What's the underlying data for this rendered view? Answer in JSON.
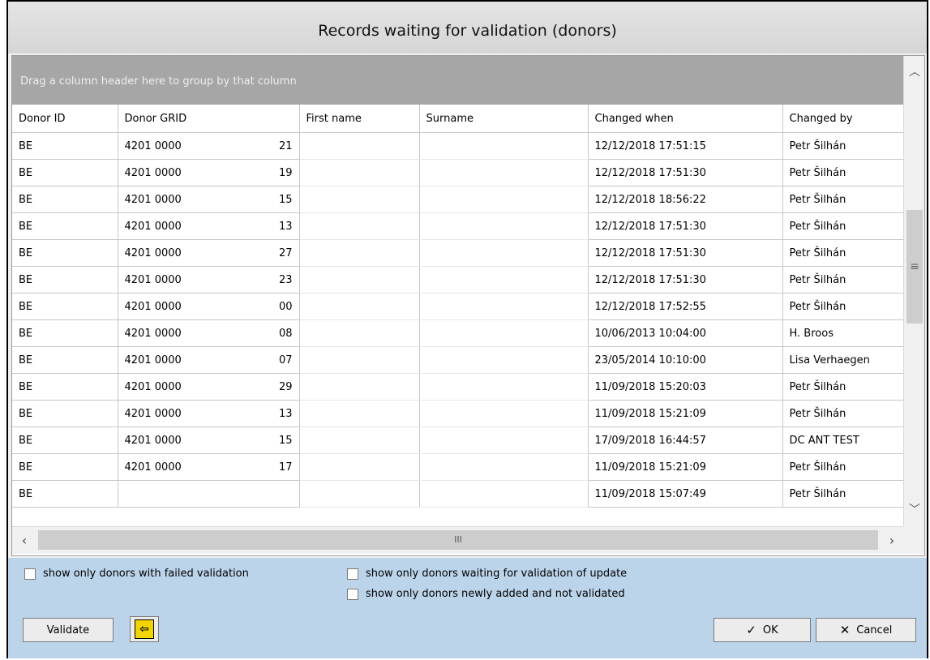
{
  "window": {
    "title": "Records waiting for validation (donors)"
  },
  "grid": {
    "group_hint": "Drag a column header here to group by that column",
    "columns": [
      "Donor ID",
      "Donor GRID",
      "First name",
      "Surname",
      "Changed when",
      "Changed by"
    ],
    "rows": [
      [
        "BE",
        "4201 0000",
        "",
        "",
        "12/12/2018 17:51:15",
        "Petr Šilhán"
      ],
      [
        "BE",
        "4201 0000",
        "",
        "",
        "12/12/2018 17:51:30",
        "Petr Šilhán"
      ],
      [
        "BE",
        "4201 0000",
        "",
        "",
        "12/12/2018 18:56:22",
        "Petr Šilhán"
      ],
      [
        "BE",
        "4201 0000",
        "",
        "",
        "12/12/2018 17:51:30",
        "Petr Šilhán"
      ],
      [
        "BE",
        "4201 0000",
        "",
        "",
        "12/12/2018 17:51:30",
        "Petr Šilhán"
      ],
      [
        "BE",
        "4201 0000",
        "",
        "",
        "12/12/2018 17:51:30",
        "Petr Šilhán"
      ],
      [
        "BE",
        "4201 0000",
        "",
        "",
        "12/12/2018 17:52:55",
        "Petr Šilhán"
      ],
      [
        "BE",
        "4201 0000",
        "",
        "",
        "10/06/2013 10:04:00",
        "H. Broos"
      ],
      [
        "BE",
        "4201 0000",
        "",
        "",
        "23/05/2014 10:10:00",
        "Lisa Verhaegen"
      ],
      [
        "BE",
        "4201 0000",
        "",
        "",
        "11/09/2018 15:20:03",
        "Petr Šilhán"
      ],
      [
        "BE",
        "4201 0000",
        "",
        "",
        "11/09/2018 15:21:09",
        "Petr Šilhán"
      ],
      [
        "BE",
        "4201 0000",
        "",
        "",
        "17/09/2018 16:44:57",
        "DC ANT TEST"
      ],
      [
        "BE",
        "4201 0000",
        "",
        "",
        "11/09/2018 15:21:09",
        "Petr Šilhán"
      ],
      [
        "BE",
        "",
        "",
        "",
        "11/09/2018 15:07:49",
        "Petr Šilhán"
      ]
    ],
    "grid_suffixes": [
      "21",
      "19",
      "15",
      "13",
      "27",
      "23",
      "00",
      "08",
      "07",
      "29",
      "13",
      "15",
      "17",
      ""
    ]
  },
  "filters": {
    "failed": "show only donors with failed validation",
    "update": "show only donors waiting for validation of update",
    "new": "show only donors newly added and not validated"
  },
  "buttons": {
    "validate": "Validate",
    "ok": "OK",
    "cancel": "Cancel"
  },
  "icons": [
    "scroll-up-icon",
    "scroll-down-icon",
    "scroll-left-icon",
    "scroll-right-icon",
    "grip-icon",
    "exit-door-icon",
    "ok-check-icon",
    "cancel-x-icon"
  ],
  "colors": {
    "group_panel": "#a6a6a6",
    "bottom_panel": "#bcd4ea"
  }
}
